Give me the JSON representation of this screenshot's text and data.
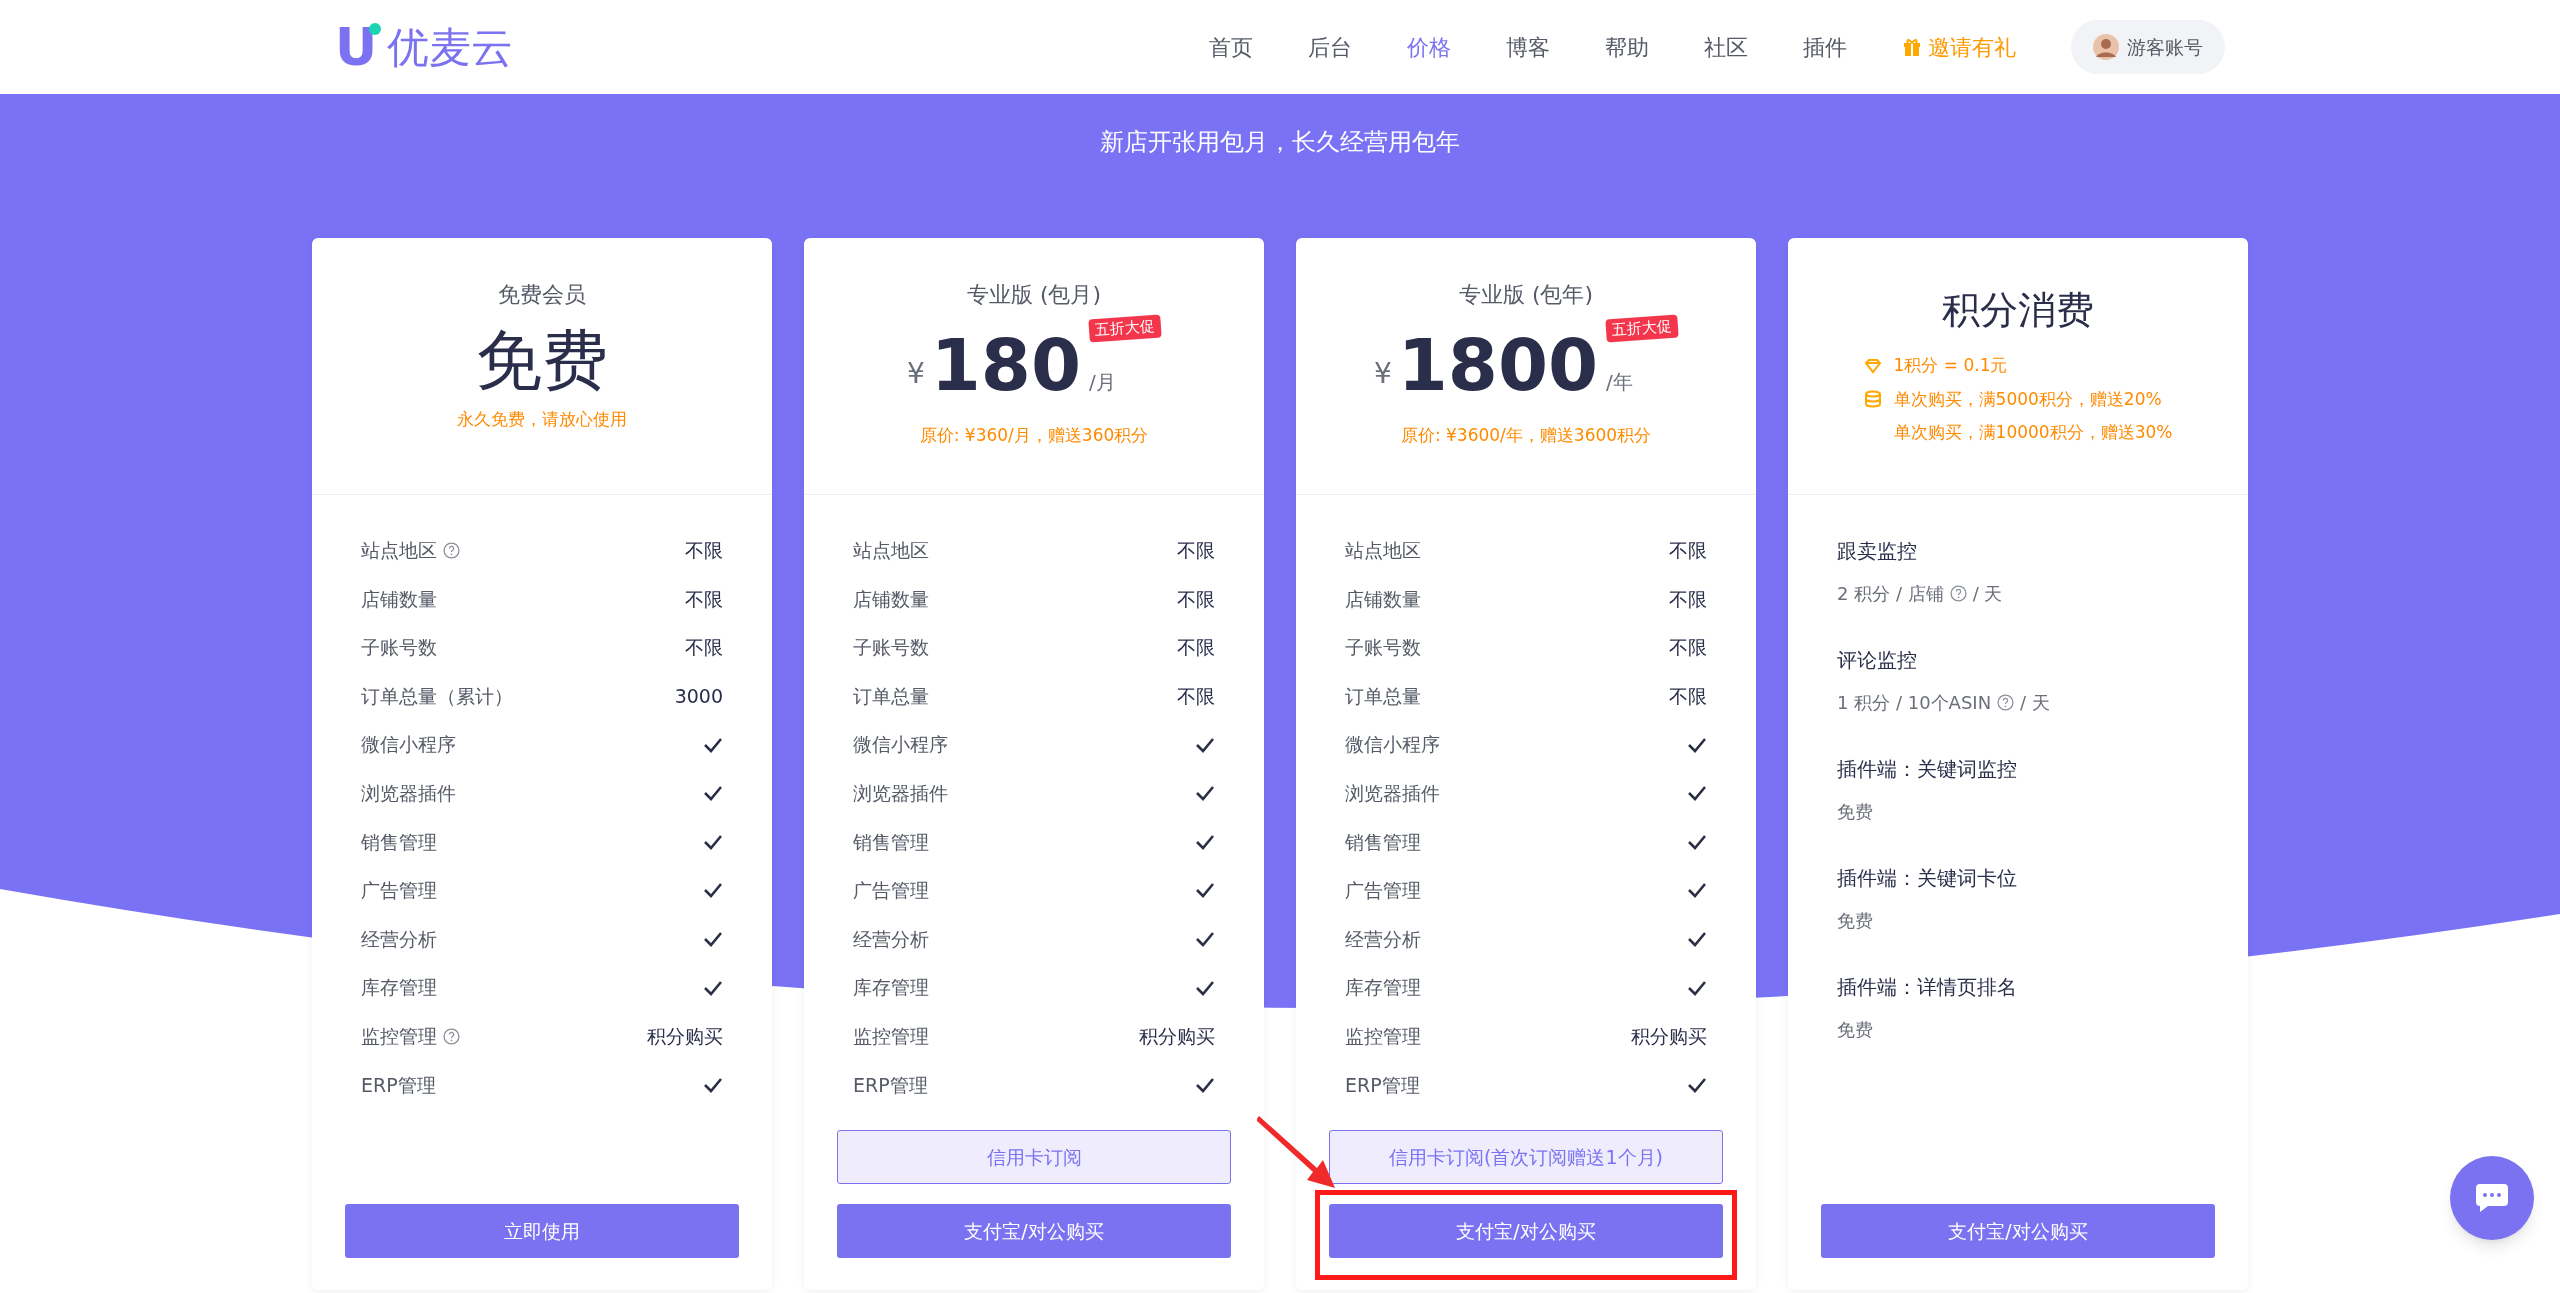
{
  "logo": {
    "mark": "U",
    "name": "优麦云"
  },
  "nav": [
    {
      "label": "首页",
      "selected": false
    },
    {
      "label": "后台",
      "selected": false
    },
    {
      "label": "价格",
      "selected": true
    },
    {
      "label": "博客",
      "selected": false
    },
    {
      "label": "帮助",
      "selected": false
    },
    {
      "label": "社区",
      "selected": false
    },
    {
      "label": "插件",
      "selected": false
    }
  ],
  "invite": {
    "label": "邀请有礼"
  },
  "account": {
    "label": "游客账号"
  },
  "tagline": "新店开张用包月，长久经营用包年",
  "plans": [
    {
      "title": "免费会员",
      "kind": "free",
      "headline": "免费",
      "note": "永久免费，请放心使用",
      "features": [
        {
          "label": "站点地区",
          "help": true,
          "kind": "text",
          "value": "不限"
        },
        {
          "label": "店铺数量",
          "help": false,
          "kind": "text",
          "value": "不限"
        },
        {
          "label": "子账号数",
          "help": false,
          "kind": "text",
          "value": "不限"
        },
        {
          "label": "订单总量（累计）",
          "help": false,
          "kind": "text",
          "value": "3000"
        },
        {
          "label": "微信小程序",
          "help": false,
          "kind": "check"
        },
        {
          "label": "浏览器插件",
          "help": false,
          "kind": "check"
        },
        {
          "label": "销售管理",
          "help": false,
          "kind": "check"
        },
        {
          "label": "广告管理",
          "help": false,
          "kind": "check"
        },
        {
          "label": "经营分析",
          "help": false,
          "kind": "check"
        },
        {
          "label": "库存管理",
          "help": false,
          "kind": "check"
        },
        {
          "label": "监控管理",
          "help": true,
          "kind": "text",
          "value": "积分购买"
        },
        {
          "label": "ERP管理",
          "help": false,
          "kind": "check"
        }
      ],
      "buttons": [
        {
          "label": "立即使用",
          "kind": "primary",
          "highlighted": false
        }
      ]
    },
    {
      "title": "专业版 (包月)",
      "kind": "paid",
      "currency": "¥",
      "price": "180",
      "unit": "/月",
      "badge": "五折大促",
      "note": "原价: ¥360/月，赠送360积分",
      "features": [
        {
          "label": "站点地区",
          "help": false,
          "kind": "text",
          "value": "不限"
        },
        {
          "label": "店铺数量",
          "help": false,
          "kind": "text",
          "value": "不限"
        },
        {
          "label": "子账号数",
          "help": false,
          "kind": "text",
          "value": "不限"
        },
        {
          "label": "订单总量",
          "help": false,
          "kind": "text",
          "value": "不限"
        },
        {
          "label": "微信小程序",
          "help": false,
          "kind": "check"
        },
        {
          "label": "浏览器插件",
          "help": false,
          "kind": "check"
        },
        {
          "label": "销售管理",
          "help": false,
          "kind": "check"
        },
        {
          "label": "广告管理",
          "help": false,
          "kind": "check"
        },
        {
          "label": "经营分析",
          "help": false,
          "kind": "check"
        },
        {
          "label": "库存管理",
          "help": false,
          "kind": "check"
        },
        {
          "label": "监控管理",
          "help": false,
          "kind": "text",
          "value": "积分购买"
        },
        {
          "label": "ERP管理",
          "help": false,
          "kind": "check"
        }
      ],
      "buttons": [
        {
          "label": "信用卡订阅",
          "kind": "outline",
          "highlighted": false
        },
        {
          "label": "支付宝/对公购买",
          "kind": "primary",
          "highlighted": false
        }
      ]
    },
    {
      "title": "专业版 (包年)",
      "kind": "paid",
      "currency": "¥",
      "price": "1800",
      "unit": "/年",
      "badge": "五折大促",
      "note": "原价: ¥3600/年，赠送3600积分",
      "features": [
        {
          "label": "站点地区",
          "help": false,
          "kind": "text",
          "value": "不限"
        },
        {
          "label": "店铺数量",
          "help": false,
          "kind": "text",
          "value": "不限"
        },
        {
          "label": "子账号数",
          "help": false,
          "kind": "text",
          "value": "不限"
        },
        {
          "label": "订单总量",
          "help": false,
          "kind": "text",
          "value": "不限"
        },
        {
          "label": "微信小程序",
          "help": false,
          "kind": "check"
        },
        {
          "label": "浏览器插件",
          "help": false,
          "kind": "check"
        },
        {
          "label": "销售管理",
          "help": false,
          "kind": "check"
        },
        {
          "label": "广告管理",
          "help": false,
          "kind": "check"
        },
        {
          "label": "经营分析",
          "help": false,
          "kind": "check"
        },
        {
          "label": "库存管理",
          "help": false,
          "kind": "check"
        },
        {
          "label": "监控管理",
          "help": false,
          "kind": "text",
          "value": "积分购买"
        },
        {
          "label": "ERP管理",
          "help": false,
          "kind": "check"
        }
      ],
      "buttons": [
        {
          "label": "信用卡订阅(首次订阅赠送1个月)",
          "kind": "outline",
          "highlighted": false
        },
        {
          "label": "支付宝/对公购买",
          "kind": "primary",
          "highlighted": true
        }
      ]
    },
    {
      "title": "积分消费",
      "kind": "points",
      "rules": [
        {
          "text": "1积分 = 0.1元"
        },
        {
          "text": "单次购买，满5000积分，赠送20%"
        },
        {
          "text": "单次购买，满10000积分，赠送30%"
        }
      ],
      "items": [
        {
          "title": "跟卖监控",
          "detail": "2 积分 / 店铺",
          "help": true,
          "detail_after": "/ 天"
        },
        {
          "title": "评论监控",
          "detail": "1 积分 / 10个ASIN",
          "help": true,
          "detail_after": "/ 天"
        },
        {
          "title": "插件端：关键词监控",
          "detail": "免费",
          "help": false
        },
        {
          "title": "插件端：关键词卡位",
          "detail": "免费",
          "help": false
        },
        {
          "title": "插件端：详情页排名",
          "detail": "免费",
          "help": false
        }
      ],
      "buttons": [
        {
          "label": "支付宝/对公购买",
          "kind": "primary",
          "highlighted": false
        }
      ]
    }
  ]
}
